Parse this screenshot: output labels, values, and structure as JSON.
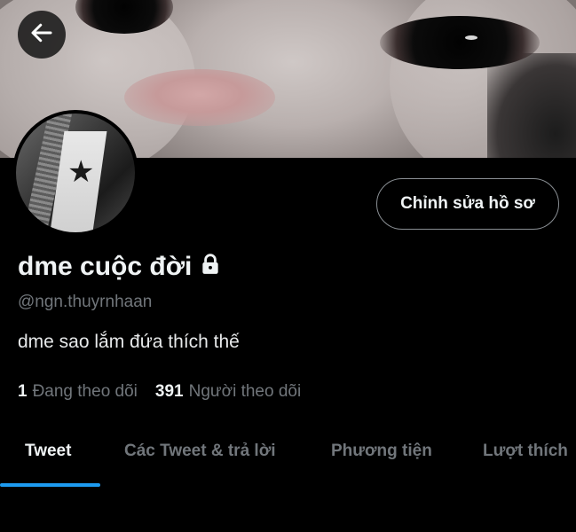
{
  "profile": {
    "display_name": "dme cuộc đời",
    "handle": "@ngn.thuyrnhaan",
    "bio": "dme sao lắm đứa thích thế",
    "following_count": "1",
    "following_label": "Đang theo dõi",
    "followers_count": "391",
    "followers_label": "Người theo dõi",
    "protected_icon": "lock-icon"
  },
  "header": {
    "back_icon": "arrow-left-icon"
  },
  "actions": {
    "edit_profile_label": "Chỉnh sửa hồ sơ"
  },
  "tabs": [
    {
      "label": "Tweet",
      "active": true
    },
    {
      "label": "Các Tweet & trả lời",
      "active": false
    },
    {
      "label": "Phương tiện",
      "active": false
    },
    {
      "label": "Lượt thích",
      "active": false
    }
  ],
  "colors": {
    "accent": "#1d9bf0",
    "background": "#000000",
    "muted_text": "#71767b"
  }
}
